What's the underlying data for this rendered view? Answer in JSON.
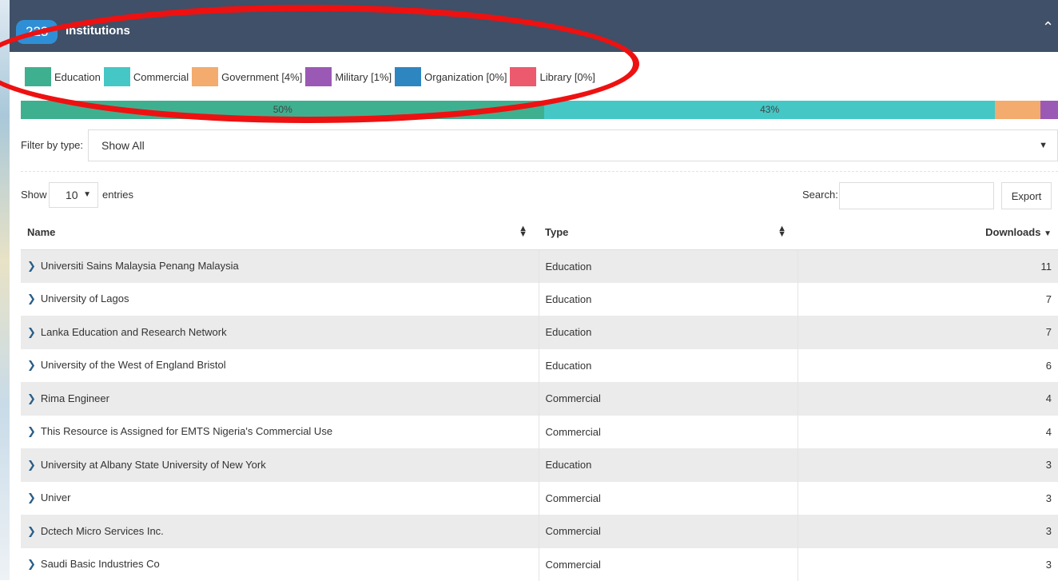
{
  "header": {
    "count": "223",
    "title": "Institutions",
    "collapse_icon": "chevron-up-icon"
  },
  "legend": [
    {
      "label": "Education",
      "color": "#3fb08f"
    },
    {
      "label": "Commercial",
      "color": "#45c7c6"
    },
    {
      "label": "Government [4%]",
      "color": "#f3ab6e"
    },
    {
      "label": "Military [1%]",
      "color": "#9b59b6"
    },
    {
      "label": "Organization [0%]",
      "color": "#2e86c1"
    },
    {
      "label": "Library [0%]",
      "color": "#ec5a6e"
    }
  ],
  "distribution": [
    {
      "percent": 50.5,
      "label": "50%",
      "color": "#3fb08f"
    },
    {
      "percent": 43.4,
      "label": "43%",
      "color": "#45c7c6"
    },
    {
      "percent": 4.4,
      "label": "",
      "color": "#f3ab6e"
    },
    {
      "percent": 1.7,
      "label": "",
      "color": "#9b59b6"
    }
  ],
  "filter": {
    "label": "Filter by type:",
    "value": "Show All"
  },
  "length": {
    "show_label": "Show",
    "value": "10",
    "entries_label": "entries"
  },
  "search": {
    "label": "Search:",
    "value": ""
  },
  "export_label": "Export",
  "table": {
    "columns": [
      "Name",
      "Type",
      "Downloads"
    ],
    "rows": [
      {
        "name": "Universiti Sains Malaysia Penang Malaysia",
        "type": "Education",
        "downloads": "11"
      },
      {
        "name": "University of Lagos",
        "type": "Education",
        "downloads": "7"
      },
      {
        "name": "Lanka Education and Research Network",
        "type": "Education",
        "downloads": "7"
      },
      {
        "name": "University of the West of England Bristol",
        "type": "Education",
        "downloads": "6"
      },
      {
        "name": "Rima Engineer",
        "type": "Commercial",
        "downloads": "4"
      },
      {
        "name": "This Resource is Assigned for EMTS Nigeria's Commercial Use",
        "type": "Commercial",
        "downloads": "4"
      },
      {
        "name": "University at Albany State University of New York",
        "type": "Education",
        "downloads": "3"
      },
      {
        "name": "Univer",
        "type": "Commercial",
        "downloads": "3"
      },
      {
        "name": "Dctech Micro Services Inc.",
        "type": "Commercial",
        "downloads": "3"
      },
      {
        "name": "Saudi Basic Industries Co",
        "type": "Commercial",
        "downloads": "3"
      }
    ]
  },
  "annotation_color": "#ee1111"
}
